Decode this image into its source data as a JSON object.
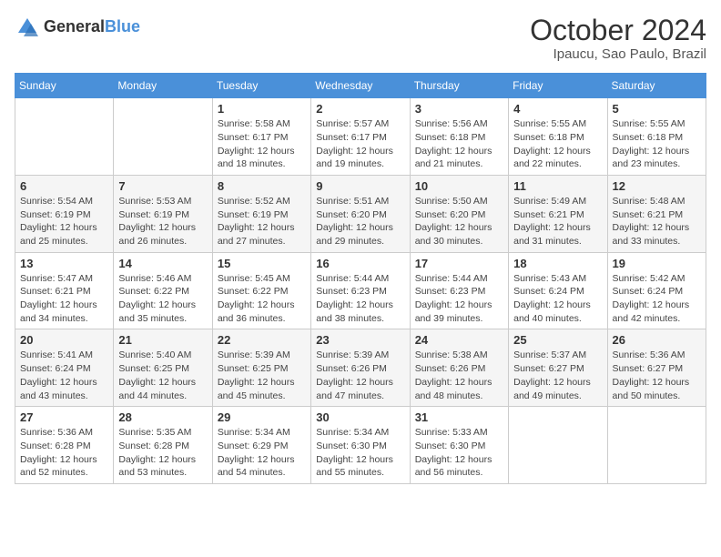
{
  "logo": {
    "text_general": "General",
    "text_blue": "Blue"
  },
  "header": {
    "month": "October 2024",
    "location": "Ipaucu, Sao Paulo, Brazil"
  },
  "weekdays": [
    "Sunday",
    "Monday",
    "Tuesday",
    "Wednesday",
    "Thursday",
    "Friday",
    "Saturday"
  ],
  "weeks": [
    [
      {
        "day": "",
        "info": ""
      },
      {
        "day": "",
        "info": ""
      },
      {
        "day": "1",
        "info": "Sunrise: 5:58 AM\nSunset: 6:17 PM\nDaylight: 12 hours and 18 minutes."
      },
      {
        "day": "2",
        "info": "Sunrise: 5:57 AM\nSunset: 6:17 PM\nDaylight: 12 hours and 19 minutes."
      },
      {
        "day": "3",
        "info": "Sunrise: 5:56 AM\nSunset: 6:18 PM\nDaylight: 12 hours and 21 minutes."
      },
      {
        "day": "4",
        "info": "Sunrise: 5:55 AM\nSunset: 6:18 PM\nDaylight: 12 hours and 22 minutes."
      },
      {
        "day": "5",
        "info": "Sunrise: 5:55 AM\nSunset: 6:18 PM\nDaylight: 12 hours and 23 minutes."
      }
    ],
    [
      {
        "day": "6",
        "info": "Sunrise: 5:54 AM\nSunset: 6:19 PM\nDaylight: 12 hours and 25 minutes."
      },
      {
        "day": "7",
        "info": "Sunrise: 5:53 AM\nSunset: 6:19 PM\nDaylight: 12 hours and 26 minutes."
      },
      {
        "day": "8",
        "info": "Sunrise: 5:52 AM\nSunset: 6:19 PM\nDaylight: 12 hours and 27 minutes."
      },
      {
        "day": "9",
        "info": "Sunrise: 5:51 AM\nSunset: 6:20 PM\nDaylight: 12 hours and 29 minutes."
      },
      {
        "day": "10",
        "info": "Sunrise: 5:50 AM\nSunset: 6:20 PM\nDaylight: 12 hours and 30 minutes."
      },
      {
        "day": "11",
        "info": "Sunrise: 5:49 AM\nSunset: 6:21 PM\nDaylight: 12 hours and 31 minutes."
      },
      {
        "day": "12",
        "info": "Sunrise: 5:48 AM\nSunset: 6:21 PM\nDaylight: 12 hours and 33 minutes."
      }
    ],
    [
      {
        "day": "13",
        "info": "Sunrise: 5:47 AM\nSunset: 6:21 PM\nDaylight: 12 hours and 34 minutes."
      },
      {
        "day": "14",
        "info": "Sunrise: 5:46 AM\nSunset: 6:22 PM\nDaylight: 12 hours and 35 minutes."
      },
      {
        "day": "15",
        "info": "Sunrise: 5:45 AM\nSunset: 6:22 PM\nDaylight: 12 hours and 36 minutes."
      },
      {
        "day": "16",
        "info": "Sunrise: 5:44 AM\nSunset: 6:23 PM\nDaylight: 12 hours and 38 minutes."
      },
      {
        "day": "17",
        "info": "Sunrise: 5:44 AM\nSunset: 6:23 PM\nDaylight: 12 hours and 39 minutes."
      },
      {
        "day": "18",
        "info": "Sunrise: 5:43 AM\nSunset: 6:24 PM\nDaylight: 12 hours and 40 minutes."
      },
      {
        "day": "19",
        "info": "Sunrise: 5:42 AM\nSunset: 6:24 PM\nDaylight: 12 hours and 42 minutes."
      }
    ],
    [
      {
        "day": "20",
        "info": "Sunrise: 5:41 AM\nSunset: 6:24 PM\nDaylight: 12 hours and 43 minutes."
      },
      {
        "day": "21",
        "info": "Sunrise: 5:40 AM\nSunset: 6:25 PM\nDaylight: 12 hours and 44 minutes."
      },
      {
        "day": "22",
        "info": "Sunrise: 5:39 AM\nSunset: 6:25 PM\nDaylight: 12 hours and 45 minutes."
      },
      {
        "day": "23",
        "info": "Sunrise: 5:39 AM\nSunset: 6:26 PM\nDaylight: 12 hours and 47 minutes."
      },
      {
        "day": "24",
        "info": "Sunrise: 5:38 AM\nSunset: 6:26 PM\nDaylight: 12 hours and 48 minutes."
      },
      {
        "day": "25",
        "info": "Sunrise: 5:37 AM\nSunset: 6:27 PM\nDaylight: 12 hours and 49 minutes."
      },
      {
        "day": "26",
        "info": "Sunrise: 5:36 AM\nSunset: 6:27 PM\nDaylight: 12 hours and 50 minutes."
      }
    ],
    [
      {
        "day": "27",
        "info": "Sunrise: 5:36 AM\nSunset: 6:28 PM\nDaylight: 12 hours and 52 minutes."
      },
      {
        "day": "28",
        "info": "Sunrise: 5:35 AM\nSunset: 6:28 PM\nDaylight: 12 hours and 53 minutes."
      },
      {
        "day": "29",
        "info": "Sunrise: 5:34 AM\nSunset: 6:29 PM\nDaylight: 12 hours and 54 minutes."
      },
      {
        "day": "30",
        "info": "Sunrise: 5:34 AM\nSunset: 6:30 PM\nDaylight: 12 hours and 55 minutes."
      },
      {
        "day": "31",
        "info": "Sunrise: 5:33 AM\nSunset: 6:30 PM\nDaylight: 12 hours and 56 minutes."
      },
      {
        "day": "",
        "info": ""
      },
      {
        "day": "",
        "info": ""
      }
    ]
  ]
}
